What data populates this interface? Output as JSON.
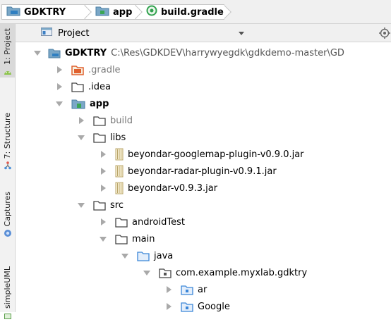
{
  "breadcrumb": [
    "GDKTRY",
    "app",
    "build.gradle"
  ],
  "tool_strip": [
    "1: Project",
    "7: Structure",
    "Captures",
    "simpleUML"
  ],
  "panel": {
    "view_label": "Project"
  },
  "tree": [
    {
      "label": "GDKTRY",
      "path": "C:\\Res\\GDKDEV\\harrywyegdk\\gdkdemo-master\\GD",
      "expanded": true,
      "icon": "module-folder-icon"
    },
    {
      "label": ".gradle",
      "expanded": false,
      "icon": "orange-folder-icon"
    },
    {
      "label": ".idea",
      "expanded": false,
      "icon": "folder-icon"
    },
    {
      "label": "app",
      "expanded": true,
      "icon": "app-module-icon"
    },
    {
      "label": "build",
      "expanded": false,
      "icon": "folder-icon"
    },
    {
      "label": "libs",
      "expanded": true,
      "icon": "folder-icon"
    },
    {
      "label": "beyondar-googlemap-plugin-v0.9.0.jar",
      "expanded": false,
      "icon": "jar-icon"
    },
    {
      "label": "beyondar-radar-plugin-v0.9.1.jar",
      "expanded": false,
      "icon": "jar-icon"
    },
    {
      "label": "beyondar-v0.9.3.jar",
      "expanded": false,
      "icon": "jar-icon"
    },
    {
      "label": "src",
      "expanded": true,
      "icon": "folder-icon"
    },
    {
      "label": "androidTest",
      "expanded": false,
      "icon": "folder-icon"
    },
    {
      "label": "main",
      "expanded": true,
      "icon": "folder-icon"
    },
    {
      "label": "java",
      "expanded": true,
      "icon": "source-folder-icon"
    },
    {
      "label": "com.example.myxlab.gdktry",
      "expanded": true,
      "icon": "package-icon"
    },
    {
      "label": "ar",
      "expanded": false,
      "icon": "package-icon"
    },
    {
      "label": "Google",
      "expanded": false,
      "icon": "package-icon"
    }
  ]
}
